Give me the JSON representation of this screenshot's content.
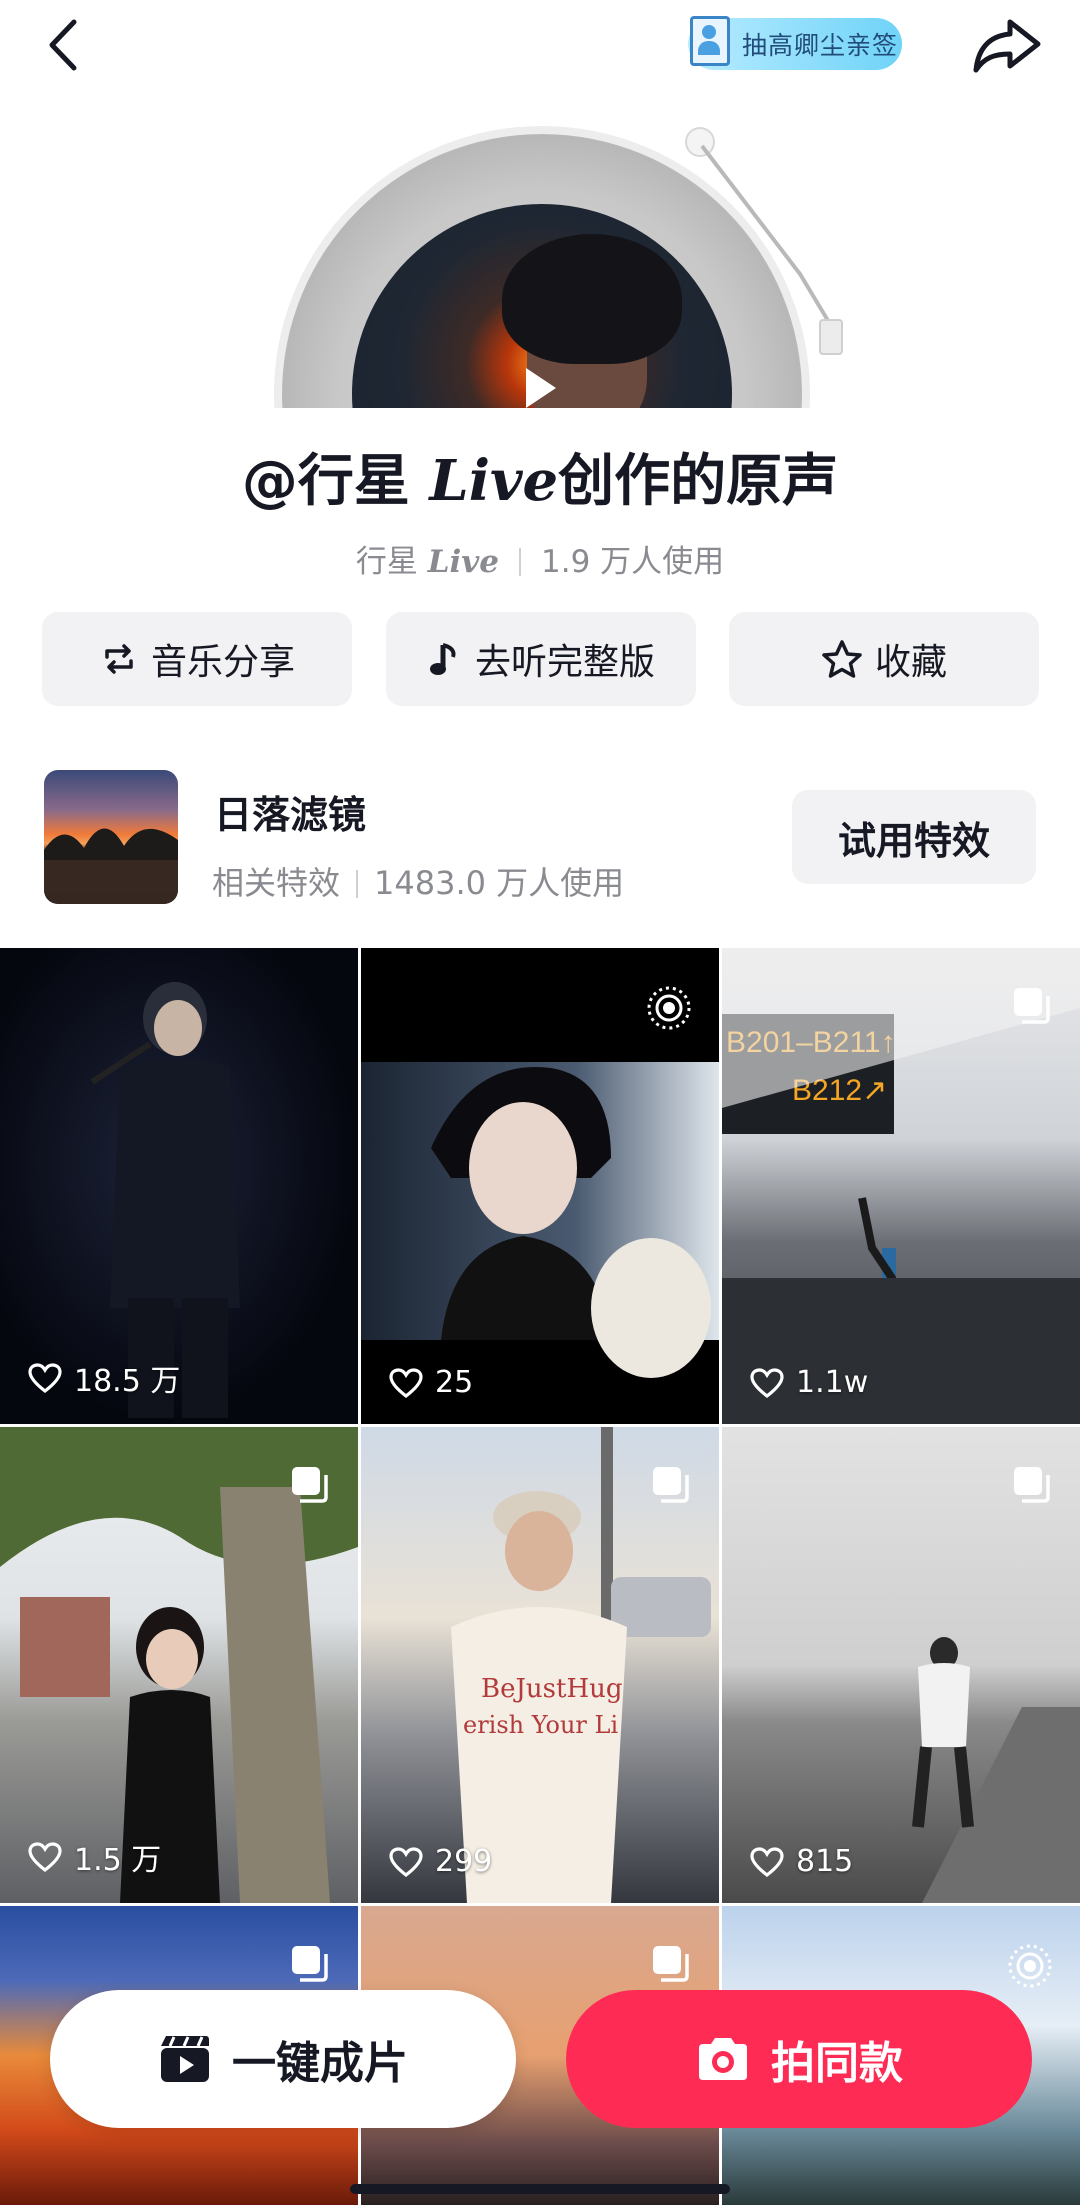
{
  "header": {
    "back_icon": "chevron-left-icon",
    "share_icon": "share-arrow-icon",
    "tag_label": "抽高卿尘亲签"
  },
  "sound": {
    "title_prefix": "@行星 ",
    "title_live": "Live",
    "title_suffix": "创作的原声",
    "author_name": "行星 ",
    "author_live": "Live",
    "usage": "1.9 万人使用"
  },
  "actions": [
    {
      "label": "音乐分享",
      "icon": "repost-icon"
    },
    {
      "label": "去听完整版",
      "icon": "music-note-icon"
    },
    {
      "label": "收藏",
      "icon": "star-icon"
    }
  ],
  "effect": {
    "name": "日落滤镜",
    "category": "相关特效",
    "usage": "1483.0 万人使用",
    "try_label": "试用特效"
  },
  "grid": [
    {
      "likes": "18.5 万",
      "badge": ""
    },
    {
      "likes": "25",
      "badge": "live-photo-icon"
    },
    {
      "likes": "1.1w",
      "badge": "multi-image-icon"
    },
    {
      "likes": "1.5 万",
      "badge": "multi-image-icon"
    },
    {
      "likes": "299",
      "badge": "multi-image-icon"
    },
    {
      "likes": "815",
      "badge": "multi-image-icon"
    },
    {
      "likes": "",
      "badge": "multi-image-icon"
    },
    {
      "likes": "",
      "badge": "multi-image-icon"
    },
    {
      "likes": "",
      "badge": "live-photo-icon"
    }
  ],
  "bottom": {
    "auto_label": "一键成片",
    "shoot_label": "拍同款"
  },
  "colors": {
    "accent": "#fe2c55",
    "button_bg": "#f2f2f4",
    "secondary_text": "#8a8b91"
  }
}
